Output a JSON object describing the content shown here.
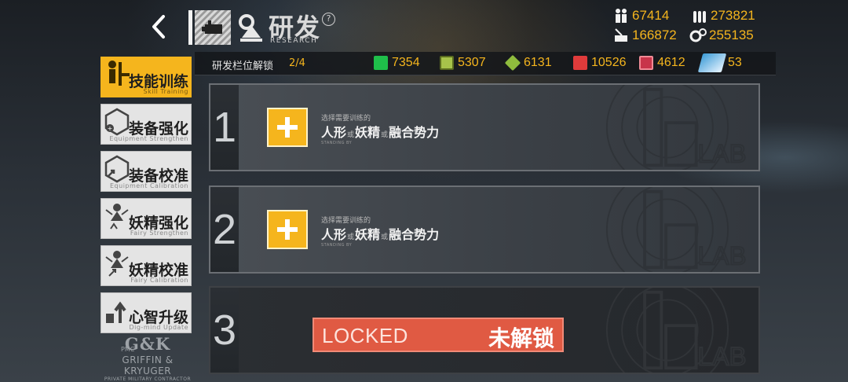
{
  "header": {
    "title_cn": "研发",
    "title_en": "RESEARCH",
    "help": "?"
  },
  "resources_top": [
    {
      "name": "manpower",
      "icon": "manpower-icon",
      "value": "67414"
    },
    {
      "name": "ammo",
      "icon": "ammo-icon",
      "value": "273821"
    },
    {
      "name": "rations",
      "icon": "rations-icon",
      "value": "166872"
    },
    {
      "name": "parts",
      "icon": "parts-icon",
      "value": "255135"
    }
  ],
  "subbar": {
    "slot_unlock_label": "研发栏位解锁",
    "slot_unlock_count": "2/4",
    "resources": [
      {
        "icon": "green-chip-icon",
        "value": "7354",
        "color": "#1fbf4a"
      },
      {
        "icon": "circuit-chip-icon",
        "value": "5307",
        "color": "#a7c34a"
      },
      {
        "icon": "green-core-icon",
        "value": "6131",
        "color": "#8fbc3d"
      },
      {
        "icon": "red-data-icon",
        "value": "10526",
        "color": "#e03b3b"
      },
      {
        "icon": "fairy-data-icon",
        "value": "4612",
        "color": "#c8344a"
      },
      {
        "icon": "ticket-icon",
        "value": "53",
        "color": "#3b9bd6"
      }
    ]
  },
  "menu": {
    "items": [
      {
        "label": "技能训练",
        "sub": "Skill Training",
        "active": true
      },
      {
        "label": "装备强化",
        "sub": "Equipment Strengthen",
        "active": false
      },
      {
        "label": "装备校准",
        "sub": "Equipment Calibration",
        "active": false
      },
      {
        "label": "妖精强化",
        "sub": "Fairy Strengthen",
        "active": false
      },
      {
        "label": "妖精校准",
        "sub": "Fairy Calibration",
        "active": false
      },
      {
        "label": "心智升级",
        "sub": "Dig-mind Update",
        "active": false
      }
    ]
  },
  "brand": {
    "pmc": "PMC",
    "mark": "G&K",
    "name": "GRIFFIN & KRYUGER",
    "sub": "PRIVATE MILITARY CONTRACTOR"
  },
  "slots": [
    {
      "number": "1",
      "hint": "选择需要训练的",
      "target_a": "人形",
      "or1": "或",
      "target_b": "妖精",
      "or2": "或",
      "target_c": "融合势力",
      "status": "STANDING BY"
    },
    {
      "number": "2",
      "hint": "选择需要训练的",
      "target_a": "人形",
      "or1": "或",
      "target_b": "妖精",
      "or2": "或",
      "target_c": "融合势力",
      "status": "STANDING BY"
    },
    {
      "number": "3",
      "locked_en": "LOCKED",
      "locked_cn": "未解锁"
    }
  ],
  "lab_mark": "16LAB",
  "colors": {
    "accent": "#f5b51d",
    "locked": "#e05a43"
  }
}
